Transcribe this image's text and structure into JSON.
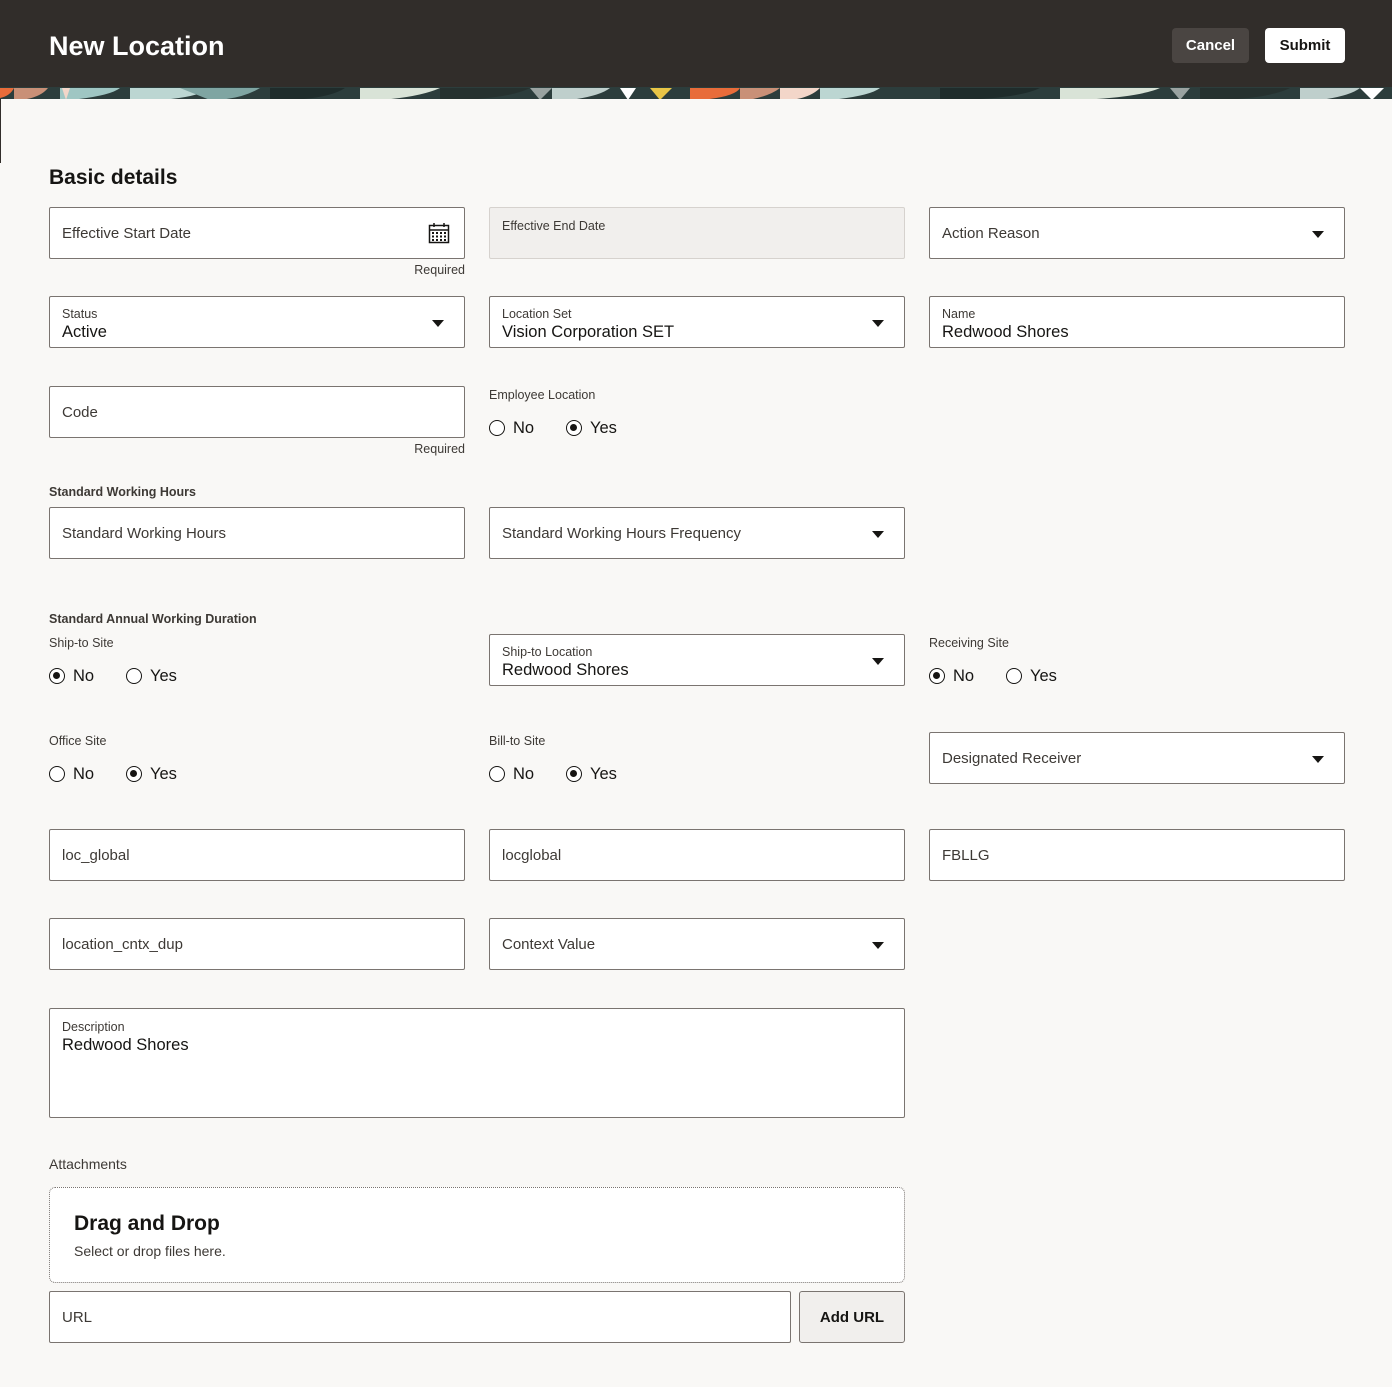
{
  "header": {
    "title": "New Location",
    "cancel_label": "Cancel",
    "submit_label": "Submit"
  },
  "section": {
    "title": "Basic details"
  },
  "fields": {
    "effective_start_date": {
      "placeholder": "Effective Start Date",
      "helper": "Required",
      "icon": "calendar-icon"
    },
    "effective_end_date": {
      "label": "Effective End Date"
    },
    "action_reason": {
      "placeholder": "Action Reason"
    },
    "status": {
      "label": "Status",
      "value": "Active"
    },
    "location_set": {
      "label": "Location Set",
      "value": "Vision Corporation SET"
    },
    "name": {
      "label": "Name",
      "value": "Redwood Shores"
    },
    "code": {
      "placeholder": "Code",
      "helper": "Required"
    },
    "employee_location": {
      "label": "Employee Location",
      "options": [
        "No",
        "Yes"
      ],
      "selected": "Yes"
    },
    "standard_working_hours_group": {
      "label": "Standard Working Hours"
    },
    "standard_working_hours": {
      "placeholder": "Standard Working Hours"
    },
    "standard_working_hours_frequency": {
      "placeholder": "Standard Working Hours Frequency"
    },
    "standard_annual_working_duration": {
      "label": "Standard Annual Working Duration"
    },
    "ship_to_site": {
      "label": "Ship-to Site",
      "options": [
        "No",
        "Yes"
      ],
      "selected": "No"
    },
    "ship_to_location": {
      "label": "Ship-to Location",
      "value": "Redwood Shores"
    },
    "receiving_site": {
      "label": "Receiving Site",
      "options": [
        "No",
        "Yes"
      ],
      "selected": "No"
    },
    "office_site": {
      "label": "Office Site",
      "options": [
        "No",
        "Yes"
      ],
      "selected": "Yes"
    },
    "bill_to_site": {
      "label": "Bill-to Site",
      "options": [
        "No",
        "Yes"
      ],
      "selected": "Yes"
    },
    "designated_receiver": {
      "placeholder": "Designated Receiver"
    },
    "loc_global": {
      "placeholder": "loc_global"
    },
    "locglobal": {
      "placeholder": "locglobal"
    },
    "fbllg": {
      "placeholder": "FBLLG"
    },
    "location_cntx_dup": {
      "placeholder": "location_cntx_dup"
    },
    "context_value": {
      "placeholder": "Context Value"
    },
    "description": {
      "label": "Description",
      "value": "Redwood Shores"
    }
  },
  "attachments": {
    "label": "Attachments",
    "drop_title": "Drag and Drop",
    "drop_subtitle": "Select or drop files here.",
    "url_placeholder": "URL",
    "add_url_label": "Add URL"
  },
  "colors": {
    "header_bg": "#312d2a",
    "page_bg": "#f9f8f6",
    "cancel_bg": "#4a4542",
    "banner_orange": "#e86c3a",
    "banner_teal": "#2c3d3c"
  }
}
